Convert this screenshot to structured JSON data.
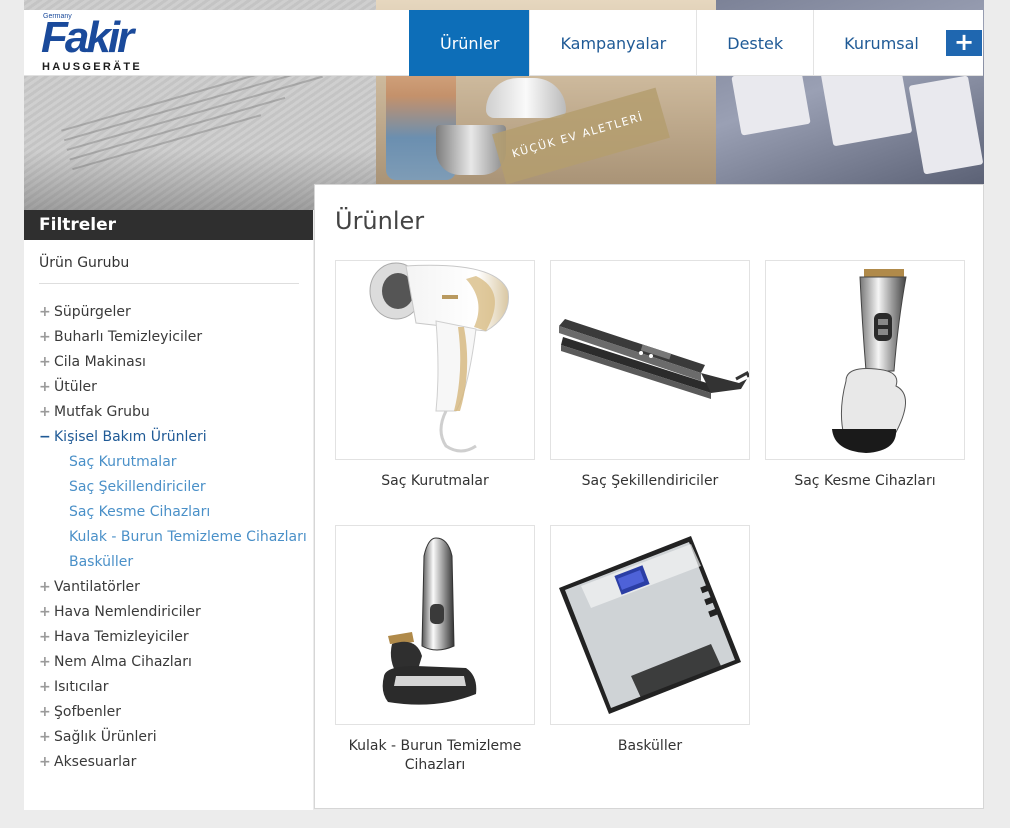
{
  "header": {
    "logo": {
      "small": "Germany",
      "brand": "Fakir",
      "tagline": "HAUSGERÄTE"
    },
    "nav": [
      {
        "label": "Ürünler",
        "active": true
      },
      {
        "label": "Kampanyalar",
        "active": false
      },
      {
        "label": "Destek",
        "active": false
      },
      {
        "label": "Kurumsal",
        "active": false
      }
    ],
    "plus_icon": "plus-icon"
  },
  "hero": {
    "ribbon_text": "KÜÇÜK EV ALETLERİ"
  },
  "sidebar": {
    "title": "Filtreler",
    "group_label": "Ürün Gurubu",
    "items": [
      {
        "label": "Süpürgeler",
        "icon": "plus-icon"
      },
      {
        "label": "Buharlı Temizleyiciler",
        "icon": "plus-icon"
      },
      {
        "label": "Cila Makinası",
        "icon": "plus-icon"
      },
      {
        "label": "Ütüler",
        "icon": "plus-icon"
      },
      {
        "label": "Mutfak Grubu",
        "icon": "plus-icon"
      },
      {
        "label": "Kişisel Bakım Ürünleri",
        "icon": "minus-icon",
        "expanded": true
      },
      {
        "label": "Vantilatörler",
        "icon": "plus-icon"
      },
      {
        "label": "Hava Nemlendiriciler",
        "icon": "plus-icon"
      },
      {
        "label": "Hava Temizleyiciler",
        "icon": "plus-icon"
      },
      {
        "label": "Nem Alma Cihazları",
        "icon": "plus-icon"
      },
      {
        "label": "Isıtıcılar",
        "icon": "plus-icon"
      },
      {
        "label": "Şofbenler",
        "icon": "plus-icon"
      },
      {
        "label": "Sağlık Ürünleri",
        "icon": "plus-icon"
      },
      {
        "label": "Aksesuarlar",
        "icon": "plus-icon"
      }
    ],
    "subitems": [
      {
        "label": "Saç Kurutmalar"
      },
      {
        "label": "Saç Şekillendiriciler"
      },
      {
        "label": "Saç Kesme Cihazları"
      },
      {
        "label": "Kulak - Burun Temizleme Cihazları"
      },
      {
        "label": "Basküller"
      }
    ]
  },
  "main": {
    "title": "Ürünler",
    "products": [
      {
        "label": "Saç Kurutmalar",
        "image": "hair-dryer"
      },
      {
        "label": "Saç Şekillendiriciler",
        "image": "hair-straightener"
      },
      {
        "label": "Saç Kesme Cihazları",
        "image": "hair-clipper"
      },
      {
        "label": "Kulak - Burun Temizleme Cihazları",
        "image": "nose-trimmer"
      },
      {
        "label": "Basküller",
        "image": "bathroom-scale"
      }
    ]
  },
  "colors": {
    "accent": "#0d6eb8",
    "link": "#1f5a96",
    "sublink": "#4a90c8",
    "sidebar_header": "#2f2f2f"
  }
}
